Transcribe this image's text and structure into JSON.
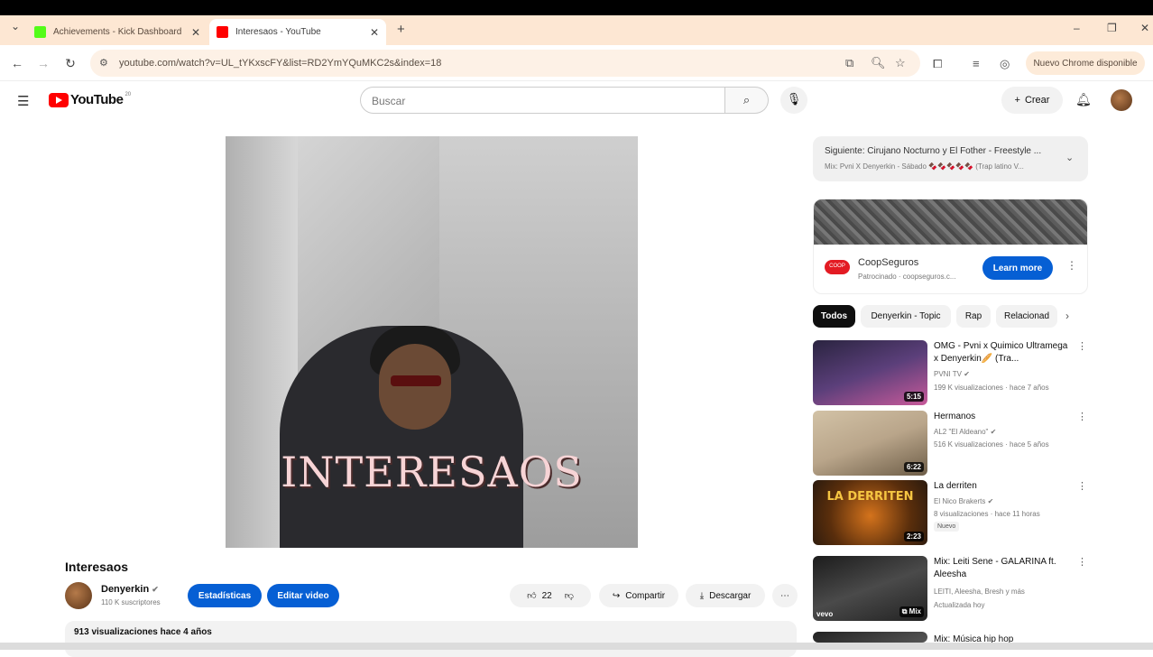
{
  "browser": {
    "tabs": [
      {
        "title": "Achievements - Kick Dashboard",
        "favicon_color": "#53fc18",
        "active": false
      },
      {
        "title": "Interesaos - YouTube",
        "favicon_color": "#ff0000",
        "active": true
      }
    ],
    "new_tab_icon": "plus-icon",
    "url": "youtube.com/watch?v=UL_tYKxscFY&list=RD2YmYQuMKC2s&index=18",
    "new_chrome_label": "Nuevo Chrome disponible"
  },
  "yt_header": {
    "logo_text": "YouTube",
    "logo_sup": "20",
    "search_placeholder": "Buscar",
    "create_label": "Crear"
  },
  "video": {
    "overlay_title": "INTERESAOS",
    "title": "Interesaos",
    "channel": "Denyerkin",
    "subscribers": "110 K suscriptores",
    "stats_button": "Estadísticas",
    "edit_button": "Editar video",
    "likes": "22",
    "share_label": "Compartir",
    "download_label": "Descargar",
    "description_meta": "913 visualizaciones  hace 4 años"
  },
  "sidebar": {
    "next_label": "Siguiente: Cirujano Nocturno y El Fother - Freestyle ...",
    "next_sub": "Mix: Pvni X Denyerkin - Sábado 🍫🍫🍫🍫🍫 (Trap latino V...",
    "ad": {
      "logo_text": "COOP",
      "name": "CoopSeguros",
      "sponsored": "Patrocinado · coopseguros.c...",
      "cta": "Learn more"
    },
    "chips": [
      "Todos",
      "Denyerkin - Topic",
      "Rap",
      "Relacionad"
    ],
    "recommendations": [
      {
        "title": "OMG - Pvni x Quimico Ultramega x Denyerkin🥖 (Tra...",
        "channel": "PVNI TV",
        "meta": "199 K visualizaciones · hace 7 años",
        "duration": "5:15",
        "thumb_colors": [
          "#2a2440",
          "#c85a9a"
        ],
        "badge": ""
      },
      {
        "title": "Hermanos",
        "channel": "AL2 \"El Aldeano\"",
        "meta": "516 K visualizaciones · hace 5 años",
        "duration": "6:22",
        "thumb_colors": [
          "#b9a58a",
          "#6e5e48"
        ],
        "badge": ""
      },
      {
        "title": "La derriten",
        "channel": "El Nico Brakerts",
        "meta": "8 visualizaciones · hace 11 horas",
        "duration": "2:23",
        "thumb_colors": [
          "#2a1a0e",
          "#d4731c"
        ],
        "badge": "Nuevo",
        "thumb_text": "LA DERRITEN"
      },
      {
        "title": "Mix: Leiti Sene - GALARINA ft. Aleesha",
        "channel": "LEITI, Aleesha, Bresh y más",
        "meta": "Actualizada hoy",
        "duration": "Mix",
        "thumb_colors": [
          "#1c1c1c",
          "#4a4a4a"
        ],
        "badge": "",
        "vevo": "vevo"
      },
      {
        "title": "Mix: Música hip hop",
        "channel": "",
        "meta": "",
        "duration": "",
        "thumb_colors": [
          "#222",
          "#555"
        ],
        "badge": ""
      }
    ]
  }
}
